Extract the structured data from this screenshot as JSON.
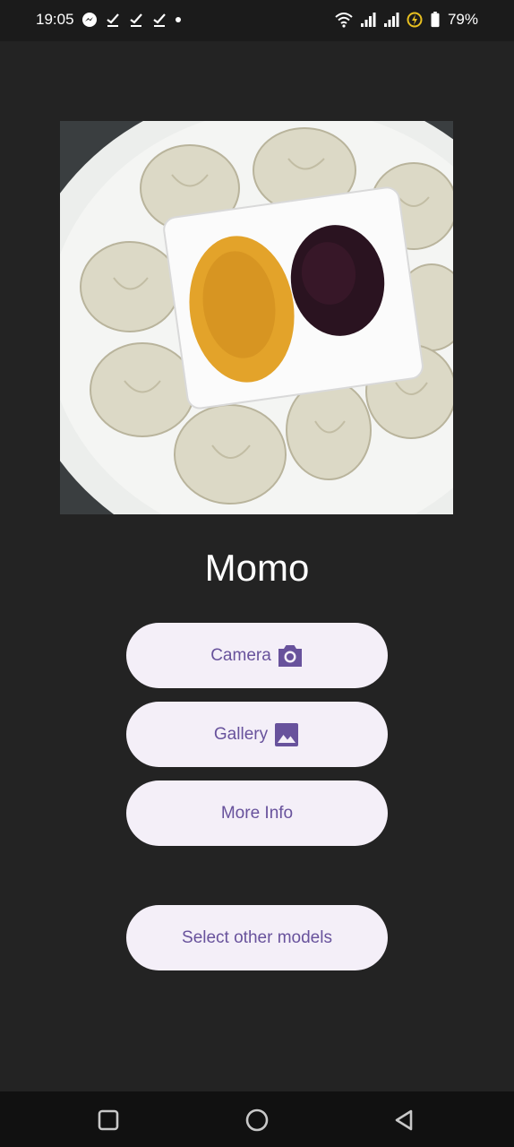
{
  "status_bar": {
    "time": "19:05",
    "battery": "79%",
    "left_icons": [
      "messenger-icon",
      "check-icon",
      "check-icon",
      "check-icon",
      "dot-icon"
    ],
    "right_icons": [
      "wifi-icon",
      "signal-icon",
      "signal-icon",
      "data-saver-icon",
      "battery-icon"
    ]
  },
  "main": {
    "prediction_label": "Momo"
  },
  "buttons": {
    "camera_label": "Camera",
    "gallery_label": "Gallery",
    "more_info_label": "More Info",
    "select_models_label": "Select other models"
  },
  "colors": {
    "background": "#232323",
    "button_bg": "#f4eff8",
    "button_text": "#68529c"
  },
  "nav_bar": {
    "icons": [
      "recents-icon",
      "home-icon",
      "back-icon"
    ]
  }
}
